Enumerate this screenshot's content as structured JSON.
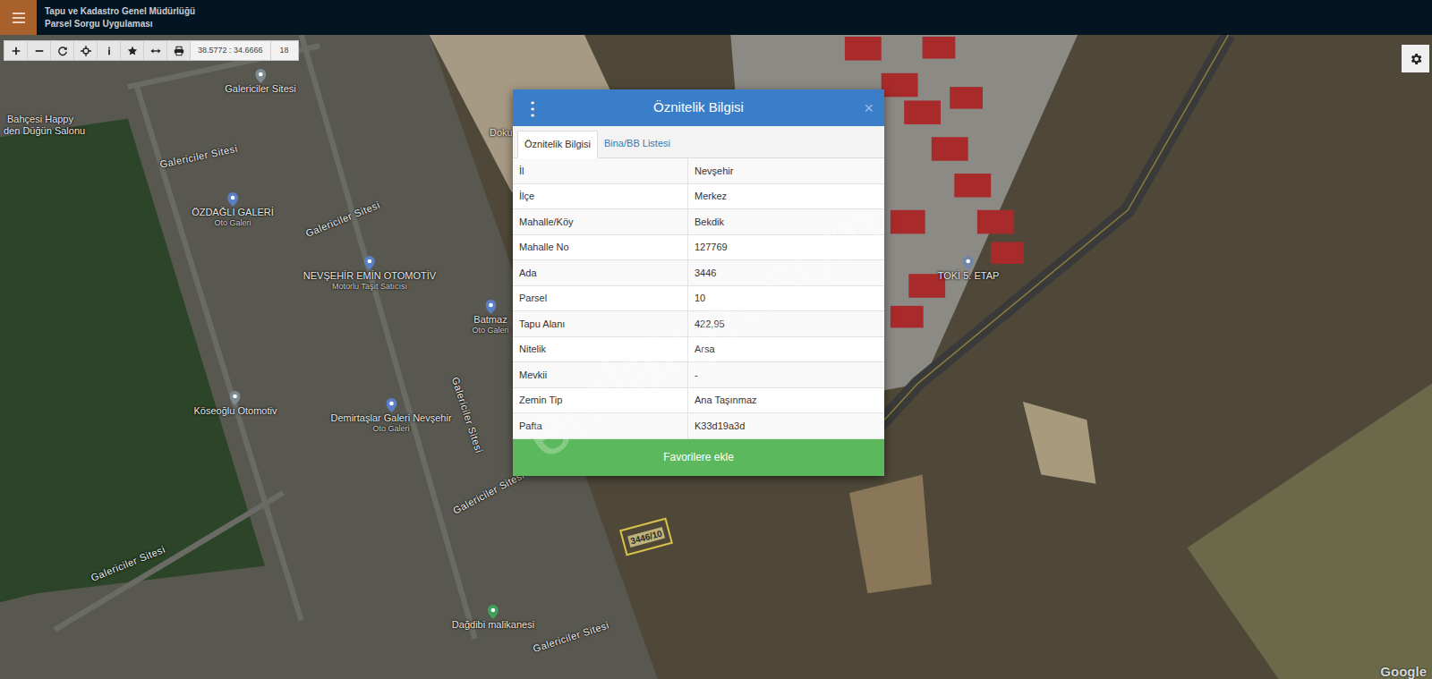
{
  "header": {
    "title": "Tapu ve Kadastro Genel Müdürlüğü",
    "subtitle": "Parsel Sorgu Uygulaması"
  },
  "toolbar": {
    "coordinates": "38.5772 : 34.6666",
    "zoom": "18"
  },
  "map": {
    "labels": [
      {
        "text": "Galericiler Sitesi",
        "kind": "place",
        "sub": "",
        "color": "#7d8b90"
      },
      {
        "text": "Bahçesi Happy",
        "kind": "plain",
        "sub": "",
        "color": ""
      },
      {
        "text": "den Düğün Salonu",
        "kind": "plain",
        "sub": "",
        "color": ""
      },
      {
        "text": "Galericiler Sitesi",
        "kind": "road",
        "sub": "",
        "color": ""
      },
      {
        "text": "ÖZDAĞLI GALERİ",
        "kind": "place",
        "sub": "Oto Galeri",
        "color": "#5b7fc4"
      },
      {
        "text": "Galericiler Sitesi",
        "kind": "road",
        "sub": "",
        "color": ""
      },
      {
        "text": "NEVŞEHİR EMİN OTOMOTİV",
        "kind": "place",
        "sub": "Motorlu Taşıt Satıcısı",
        "color": "#5b7fc4"
      },
      {
        "text": "Batmaz",
        "kind": "place",
        "sub": "Oto Galeri",
        "color": "#5b7fc4"
      },
      {
        "text": "Köseoğlu Otomotiv",
        "kind": "place",
        "sub": "",
        "color": "#7d8b90"
      },
      {
        "text": "Demirtaşlar Galeri Nevşehir",
        "kind": "place",
        "sub": "Oto Galeri",
        "color": "#5b7fc4"
      },
      {
        "text": "Galericiler Sitesi",
        "kind": "road",
        "sub": "",
        "color": ""
      },
      {
        "text": "Galericiler Sitesi",
        "kind": "road",
        "sub": "",
        "color": ""
      },
      {
        "text": "Galericiler Sitesi",
        "kind": "road",
        "sub": "",
        "color": ""
      },
      {
        "text": "Dağdibi malikanesi",
        "kind": "place",
        "sub": "",
        "color": "#3ea05a"
      },
      {
        "text": "Galericiler Sitesi",
        "kind": "road",
        "sub": "",
        "color": ""
      },
      {
        "text": "TOKİ 5. ETAP",
        "kind": "place",
        "sub": "",
        "color": "#6f86a8"
      },
      {
        "text": "Doku",
        "kind": "plain",
        "sub": "",
        "color": ""
      }
    ],
    "parcel_label": "3446/10",
    "attribution": "Google",
    "watermark": "emlakjet.com"
  },
  "dialog": {
    "menu_icon": "⋮",
    "title": "Öznitelik Bilgisi",
    "close_icon": "×",
    "tabs": [
      {
        "label": "Öznitelik Bilgisi",
        "selected": true
      },
      {
        "label": "Bina/BB Listesi",
        "selected": false
      }
    ],
    "rows": [
      {
        "label": "İl",
        "value": "Nevşehir"
      },
      {
        "label": "İlçe",
        "value": "Merkez"
      },
      {
        "label": "Mahalle/Köy",
        "value": "Bekdik"
      },
      {
        "label": "Mahalle No",
        "value": "127769"
      },
      {
        "label": "Ada",
        "value": "3446"
      },
      {
        "label": "Parsel",
        "value": "10"
      },
      {
        "label": "Tapu Alanı",
        "value": "422,95"
      },
      {
        "label": "Nitelik",
        "value": "Arsa"
      },
      {
        "label": "Mevkii",
        "value": "-"
      },
      {
        "label": "Zemin Tip",
        "value": "Ana Taşınmaz"
      },
      {
        "label": "Pafta",
        "value": "K33d19a3d"
      }
    ],
    "button": "Favorilere ekle"
  }
}
